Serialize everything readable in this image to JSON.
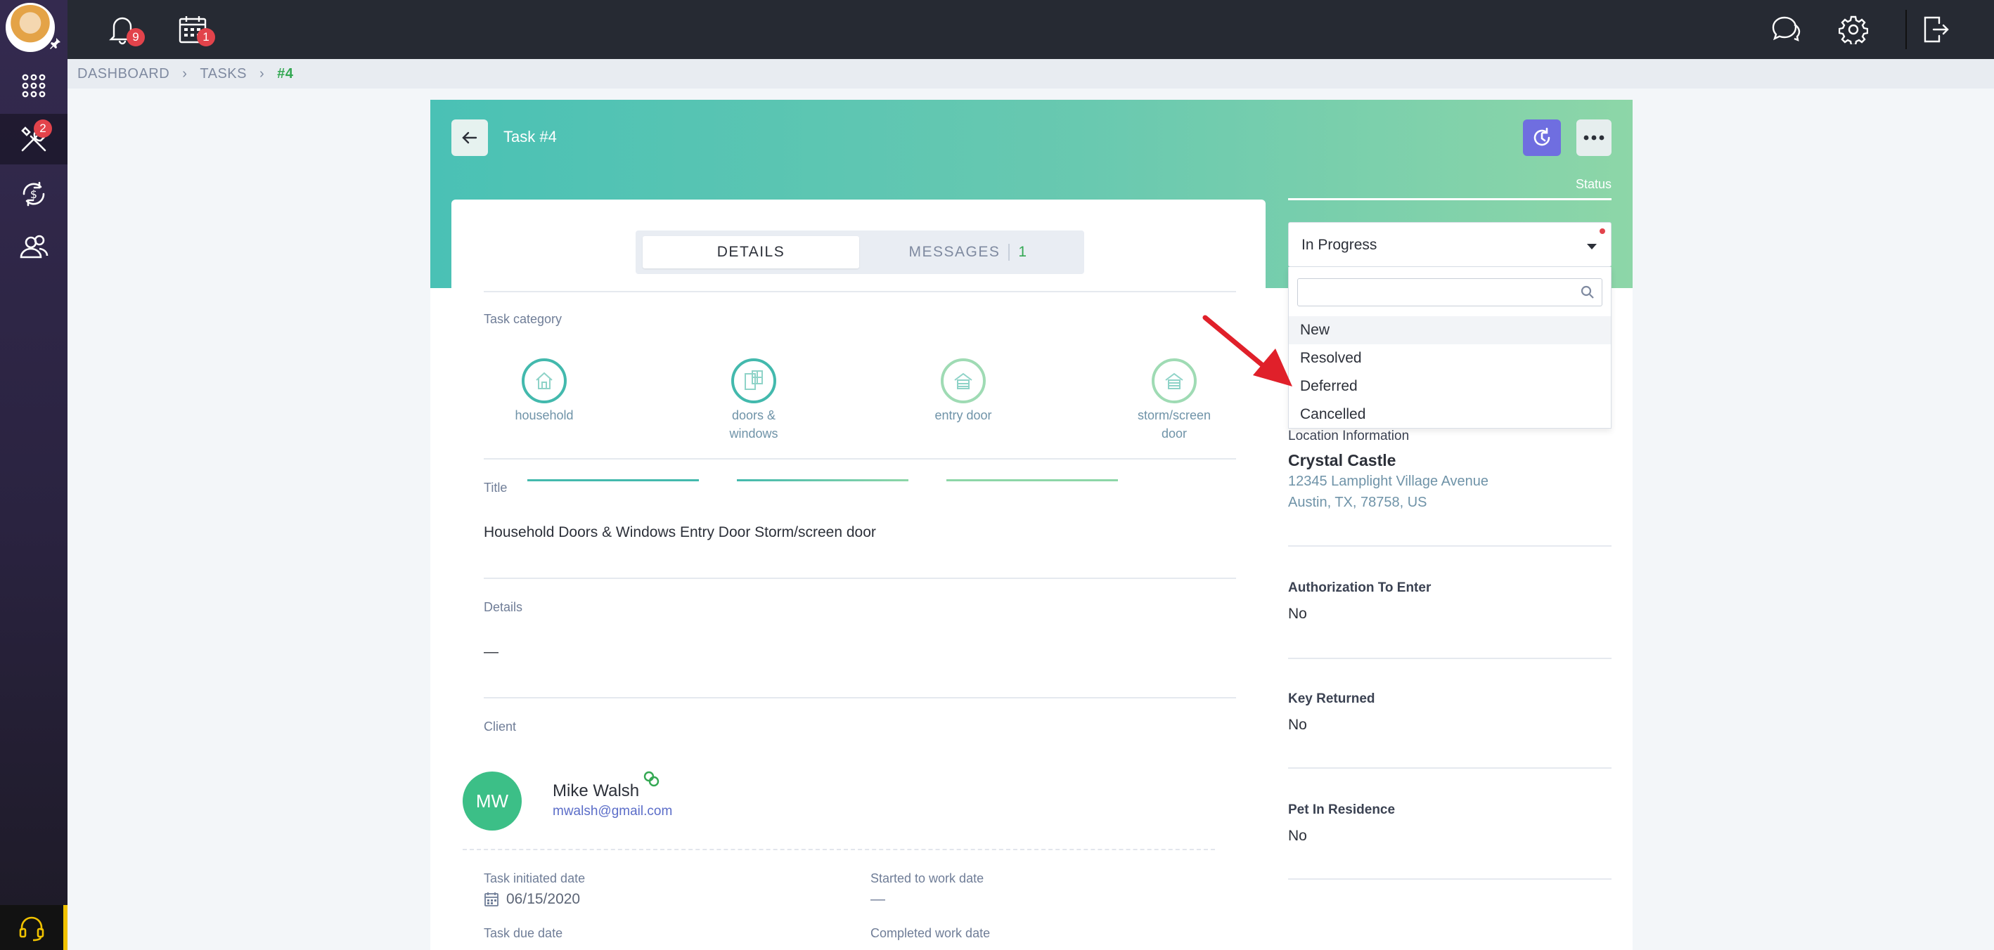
{
  "sidebar": {
    "tools_badge": "2"
  },
  "topbar": {
    "notifications_badge": "9",
    "calendar_badge": "1"
  },
  "breadcrumb": {
    "items": [
      "DASHBOARD",
      "TASKS",
      "#4"
    ]
  },
  "task": {
    "title": "Task #4",
    "tabs": [
      {
        "label": "DETAILS"
      },
      {
        "label": "MESSAGES",
        "count": "1"
      }
    ],
    "category_label": "Task category",
    "categories": [
      {
        "name": "household",
        "lines": [
          "household"
        ]
      },
      {
        "name": "doors & windows",
        "lines": [
          "doors &",
          "windows"
        ]
      },
      {
        "name": "entry door",
        "lines": [
          "entry door"
        ]
      },
      {
        "name": "storm/screen door",
        "lines": [
          "storm/screen",
          "door"
        ]
      }
    ],
    "title_label": "Title",
    "title_value": "Household Doors & Windows Entry Door Storm/screen door",
    "details_label": "Details",
    "details_value": "—",
    "client_label": "Client",
    "client": {
      "initials": "MW",
      "name": "Mike Walsh",
      "email": "mwalsh@gmail.com"
    },
    "initiated_label": "Task initiated date",
    "initiated_value": "06/15/2020",
    "started_label": "Started to work date",
    "started_value": "—",
    "due_label": "Task due date",
    "completed_label": "Completed work date"
  },
  "status": {
    "label": "Status",
    "current": "In Progress",
    "search_placeholder": "",
    "options": [
      "New",
      "Resolved",
      "Deferred",
      "Cancelled"
    ]
  },
  "location": {
    "label": "Location Information",
    "name": "Crystal Castle",
    "address1": "12345 Lamplight Village Avenue",
    "address2": "Austin, TX, 78758, US"
  },
  "authorization": {
    "label": "Authorization To Enter",
    "value": "No"
  },
  "key_returned": {
    "label": "Key Returned",
    "value": "No"
  },
  "pet": {
    "label": "Pet In Residence",
    "value": "No"
  },
  "colors": {
    "header_start": "#4ac1b5",
    "header_end": "#8dd6a8",
    "accent_green": "#34a853",
    "badge_red": "#e2434b",
    "refresh_purple": "#6f6ee0"
  }
}
